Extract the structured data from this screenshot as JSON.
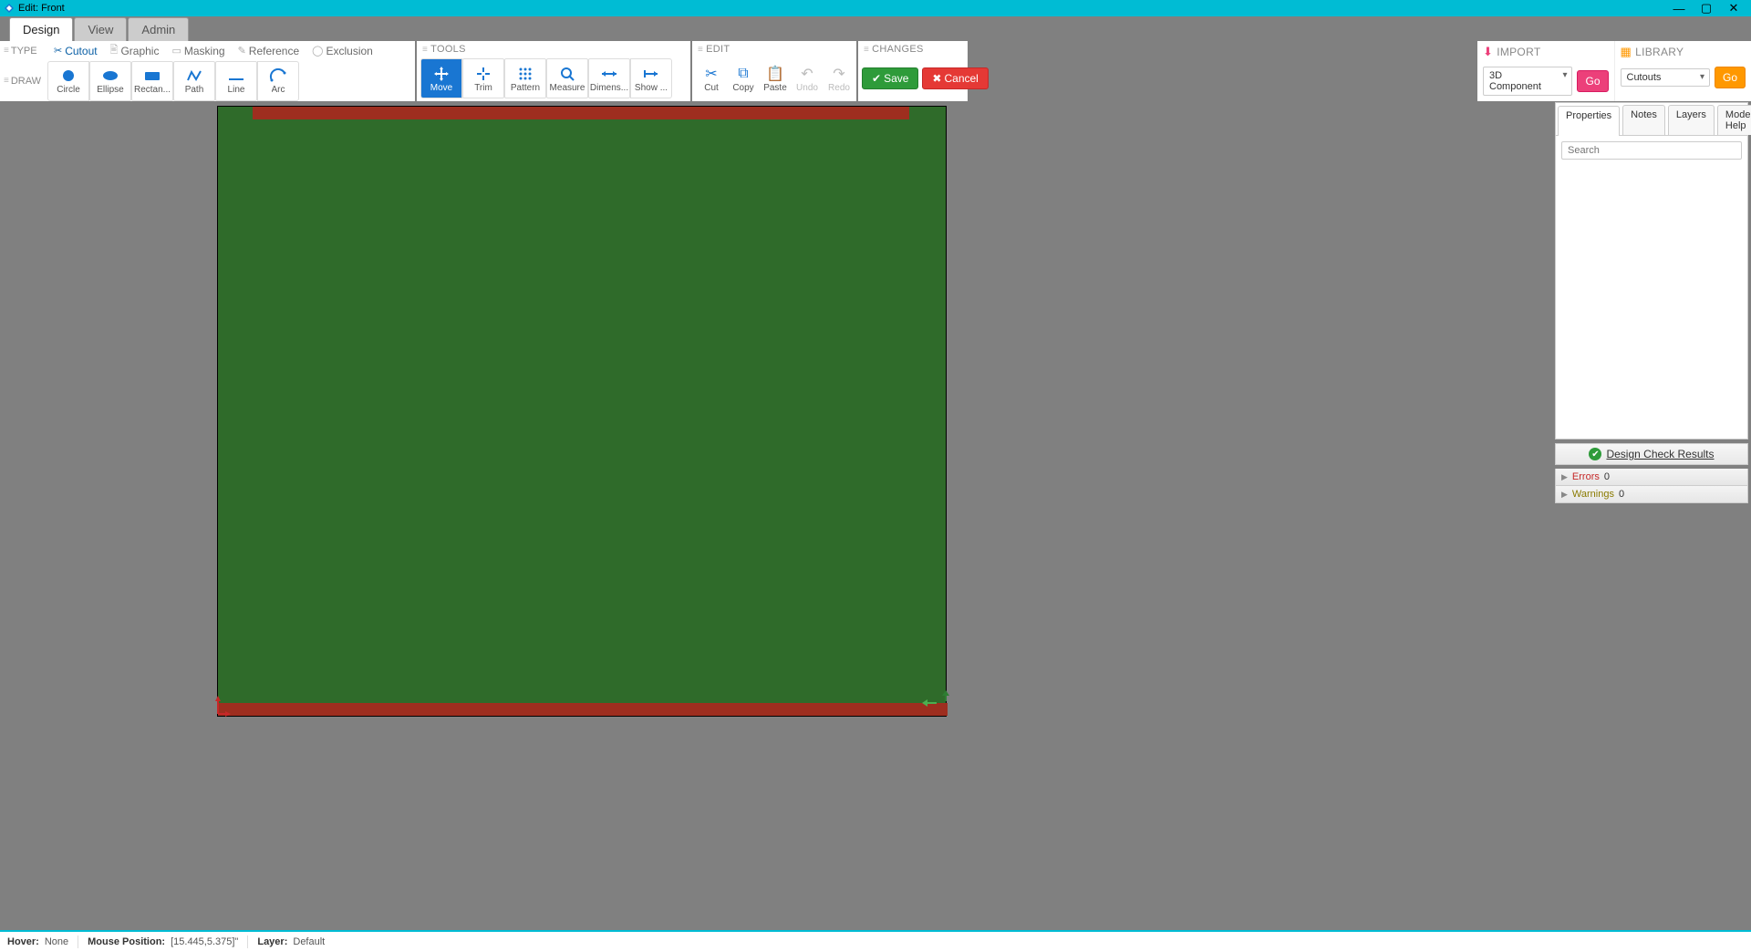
{
  "window": {
    "title": "Edit: Front"
  },
  "tabs": {
    "design": "Design",
    "view": "View",
    "admin": "Admin"
  },
  "type": {
    "label_type": "TYPE",
    "label_draw": "DRAW",
    "options": {
      "cutout": "Cutout",
      "graphic": "Graphic",
      "masking": "Masking",
      "reference": "Reference",
      "exclusion": "Exclusion"
    },
    "draw": {
      "circle": "Circle",
      "ellipse": "Ellipse",
      "rectangle": "Rectan...",
      "path": "Path",
      "line": "Line",
      "arc": "Arc"
    }
  },
  "tools": {
    "header": "TOOLS",
    "move": "Move",
    "trim": "Trim",
    "pattern": "Pattern",
    "measure": "Measure",
    "dimens": "Dimens...",
    "show": "Show ..."
  },
  "edit": {
    "header": "EDIT",
    "cut": "Cut",
    "copy": "Copy",
    "paste": "Paste",
    "undo": "Undo",
    "redo": "Redo"
  },
  "changes": {
    "header": "CHANGES",
    "save": "Save",
    "cancel": "Cancel"
  },
  "import": {
    "header": "IMPORT",
    "option": "3D Component",
    "go": "Go"
  },
  "library": {
    "header": "LIBRARY",
    "option": "Cutouts",
    "go": "Go"
  },
  "inspector": {
    "tabs": {
      "properties": "Properties",
      "notes": "Notes",
      "layers": "Layers",
      "help": "Mode Help"
    },
    "search_placeholder": "Search",
    "dcr": "Design Check Results",
    "errors_label": "Errors",
    "errors_count": "0",
    "warnings_label": "Warnings",
    "warnings_count": "0"
  },
  "status": {
    "hover_label": "Hover:",
    "hover_value": "None",
    "mouse_label": "Mouse Position:",
    "mouse_value": "[15.445,5.375]\"",
    "layer_label": "Layer:",
    "layer_value": "Default"
  }
}
